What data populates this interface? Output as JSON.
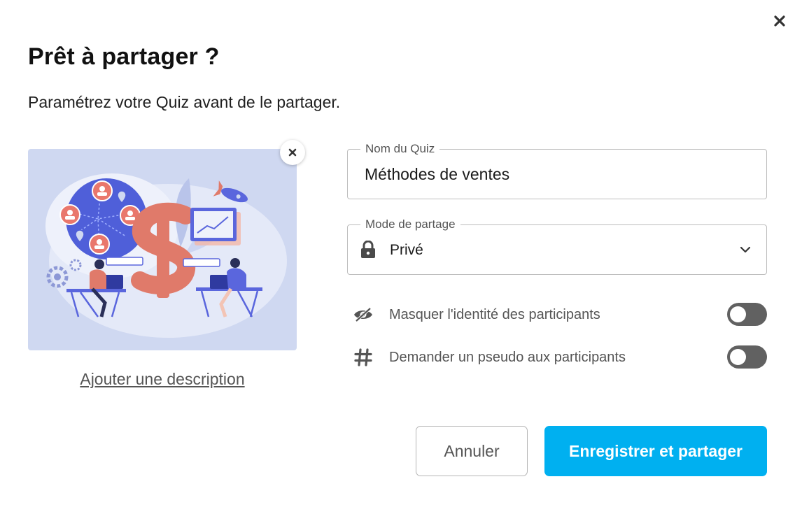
{
  "dialog": {
    "title": "Prêt à partager ?",
    "subtitle": "Paramétrez votre Quiz avant de le partager.",
    "add_description_label": "Ajouter une description"
  },
  "quiz_name": {
    "label": "Nom du Quiz",
    "value": "Méthodes de ventes"
  },
  "share_mode": {
    "label": "Mode de partage",
    "value": "Privé",
    "icon": "lock-icon"
  },
  "options": [
    {
      "label": "Masquer l'identité des participants",
      "icon": "eye-off-icon",
      "enabled": false
    },
    {
      "label": "Demander un pseudo aux participants",
      "icon": "hashtag-icon",
      "enabled": false
    }
  ],
  "buttons": {
    "cancel_label": "Annuler",
    "save_label": "Enregistrer et partager"
  },
  "colors": {
    "primary": "#00b0f0",
    "illustration_bg": "#cfd8f1",
    "toggle_off": "#616161",
    "dollar": "#e07a6a"
  }
}
